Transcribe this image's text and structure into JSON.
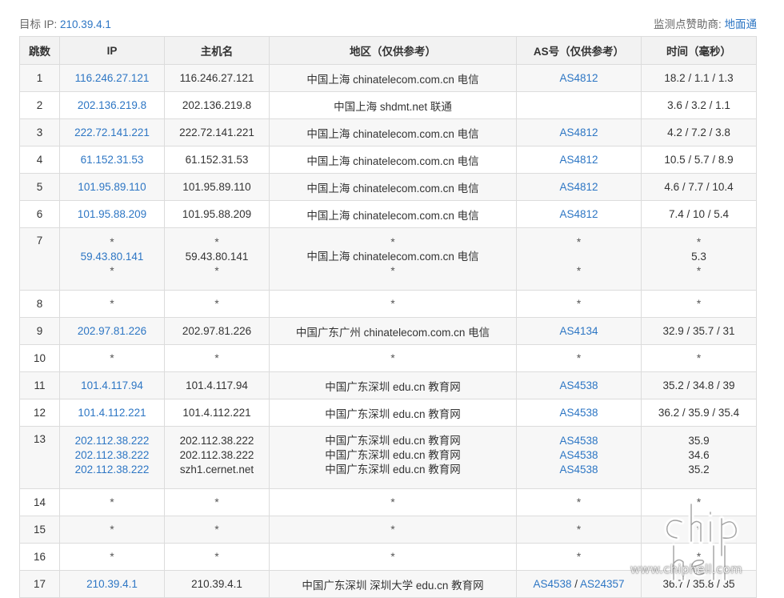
{
  "header": {
    "target_label": "目标 IP:",
    "target_ip": "210.39.4.1",
    "sponsor_label": "监测点赞助商:",
    "sponsor_name": "地面通"
  },
  "columns": [
    "跳数",
    "IP",
    "主机名",
    "地区（仅供参考）",
    "AS号（仅供参考）",
    "时间（毫秒）"
  ],
  "rows": [
    {
      "hop": "1",
      "ip": [
        "116.246.27.121"
      ],
      "host": [
        "116.246.27.121"
      ],
      "region": [
        "中国上海 chinatelecom.com.cn 电信"
      ],
      "as": [
        "AS4812"
      ],
      "time": [
        "18.2 / 1.1 / 1.3"
      ]
    },
    {
      "hop": "2",
      "ip": [
        "202.136.219.8"
      ],
      "host": [
        "202.136.219.8"
      ],
      "region": [
        "中国上海 shdmt.net 联通"
      ],
      "as": [
        ""
      ],
      "time": [
        "3.6 / 3.2 / 1.1"
      ]
    },
    {
      "hop": "3",
      "ip": [
        "222.72.141.221"
      ],
      "host": [
        "222.72.141.221"
      ],
      "region": [
        "中国上海 chinatelecom.com.cn 电信"
      ],
      "as": [
        "AS4812"
      ],
      "time": [
        "4.2 / 7.2 / 3.8"
      ]
    },
    {
      "hop": "4",
      "ip": [
        "61.152.31.53"
      ],
      "host": [
        "61.152.31.53"
      ],
      "region": [
        "中国上海 chinatelecom.com.cn 电信"
      ],
      "as": [
        "AS4812"
      ],
      "time": [
        "10.5 / 5.7 / 8.9"
      ]
    },
    {
      "hop": "5",
      "ip": [
        "101.95.89.110"
      ],
      "host": [
        "101.95.89.110"
      ],
      "region": [
        "中国上海 chinatelecom.com.cn 电信"
      ],
      "as": [
        "AS4812"
      ],
      "time": [
        "4.6 / 7.7 / 10.4"
      ]
    },
    {
      "hop": "6",
      "ip": [
        "101.95.88.209"
      ],
      "host": [
        "101.95.88.209"
      ],
      "region": [
        "中国上海 chinatelecom.com.cn 电信"
      ],
      "as": [
        "AS4812"
      ],
      "time": [
        "7.4 / 10 / 5.4"
      ]
    },
    {
      "hop": "7",
      "ip": [
        "*",
        "59.43.80.141",
        "*"
      ],
      "host": [
        "*",
        "59.43.80.141",
        "*"
      ],
      "region": [
        "*",
        "中国上海 chinatelecom.com.cn 电信",
        "*"
      ],
      "as": [
        "*",
        "",
        "*"
      ],
      "time": [
        "*",
        "5.3",
        "*"
      ]
    },
    {
      "hop": "8",
      "ip": [
        "*"
      ],
      "host": [
        "*"
      ],
      "region": [
        "*"
      ],
      "as": [
        "*"
      ],
      "time": [
        "*"
      ]
    },
    {
      "hop": "9",
      "ip": [
        "202.97.81.226"
      ],
      "host": [
        "202.97.81.226"
      ],
      "region": [
        "中国广东广州 chinatelecom.com.cn 电信"
      ],
      "as": [
        "AS4134"
      ],
      "time": [
        "32.9 / 35.7 / 31"
      ]
    },
    {
      "hop": "10",
      "ip": [
        "*"
      ],
      "host": [
        "*"
      ],
      "region": [
        "*"
      ],
      "as": [
        "*"
      ],
      "time": [
        "*"
      ]
    },
    {
      "hop": "11",
      "ip": [
        "101.4.117.94"
      ],
      "host": [
        "101.4.117.94"
      ],
      "region": [
        "中国广东深圳 edu.cn 教育网"
      ],
      "as": [
        "AS4538"
      ],
      "time": [
        "35.2 / 34.8 / 39"
      ]
    },
    {
      "hop": "12",
      "ip": [
        "101.4.112.221"
      ],
      "host": [
        "101.4.112.221"
      ],
      "region": [
        "中国广东深圳 edu.cn 教育网"
      ],
      "as": [
        "AS4538"
      ],
      "time": [
        "36.2 / 35.9 / 35.4"
      ]
    },
    {
      "hop": "13",
      "ip": [
        "202.112.38.222",
        "202.112.38.222",
        "202.112.38.222"
      ],
      "host": [
        "202.112.38.222",
        "202.112.38.222",
        "szh1.cernet.net"
      ],
      "region": [
        "中国广东深圳 edu.cn 教育网",
        "中国广东深圳 edu.cn 教育网",
        "中国广东深圳 edu.cn 教育网"
      ],
      "as": [
        "AS4538",
        "AS4538",
        "AS4538"
      ],
      "time": [
        "35.9",
        "34.6",
        "35.2"
      ]
    },
    {
      "hop": "14",
      "ip": [
        "*"
      ],
      "host": [
        "*"
      ],
      "region": [
        "*"
      ],
      "as": [
        "*"
      ],
      "time": [
        "*"
      ]
    },
    {
      "hop": "15",
      "ip": [
        "*"
      ],
      "host": [
        "*"
      ],
      "region": [
        "*"
      ],
      "as": [
        "*"
      ],
      "time": [
        "*"
      ]
    },
    {
      "hop": "16",
      "ip": [
        "*"
      ],
      "host": [
        "*"
      ],
      "region": [
        "*"
      ],
      "as": [
        "*"
      ],
      "time": [
        "*"
      ]
    },
    {
      "hop": "17",
      "ip": [
        "210.39.4.1"
      ],
      "host": [
        "210.39.4.1"
      ],
      "region": [
        "中国广东深圳 深圳大学 edu.cn 教育网"
      ],
      "as": [
        "AS4538",
        "AS24357"
      ],
      "time": [
        "36.7 / 35.8 / 35"
      ]
    }
  ],
  "watermark": {
    "logo_text": "chip hell",
    "url": "www.chiphell.com"
  },
  "colors": {
    "link": "#2d76c4",
    "header_bg": "#f2f2f2",
    "stripe_bg": "#f7f7f7",
    "border": "#dcdcdc"
  }
}
